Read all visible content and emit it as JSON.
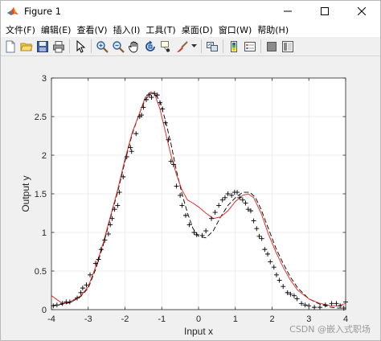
{
  "window": {
    "title": "Figure 1"
  },
  "menu": {
    "items": [
      "文件(F)",
      "编辑(E)",
      "查看(V)",
      "插入(I)",
      "工具(T)",
      "桌面(D)",
      "窗口(W)",
      "帮助(H)"
    ]
  },
  "toolbar": {
    "icons": [
      "new-figure-icon",
      "open-file-icon",
      "save-icon",
      "print-icon",
      "select-arrow-icon",
      "zoom-in-icon",
      "zoom-out-icon",
      "pan-hand-icon",
      "rotate-3d-icon",
      "data-cursor-icon",
      "brush-icon",
      "link-plot-icon",
      "colorbar-icon",
      "legend-icon",
      "hide-plot-tools-icon",
      "show-plot-tools-icon"
    ]
  },
  "watermark": "CSDN @嵌入式职场",
  "colors": {
    "fit_line": "#e8302a",
    "true_line": "#000000",
    "grid": "#e6e6e6"
  },
  "chart_data": {
    "type": "line",
    "xlabel": "Input x",
    "ylabel": "Output y",
    "xlim": [
      -4,
      4
    ],
    "ylim": [
      0,
      3
    ],
    "xticks": [
      "-4",
      "-3",
      "-2",
      "-1",
      "0",
      "1",
      "2",
      "3",
      "4"
    ],
    "yticks": [
      "0",
      "0.5",
      "1",
      "1.5",
      "2",
      "2.5",
      "3"
    ],
    "grid": true,
    "series": [
      {
        "kind": "fitted-red-line",
        "x": [
          -4,
          -3.7,
          -3.5,
          -3.2,
          -3.0,
          -2.8,
          -2.6,
          -2.4,
          -2.2,
          -2.0,
          -1.8,
          -1.6,
          -1.45,
          -1.3,
          -1.2,
          -1.05,
          -0.9,
          -0.75,
          -0.6,
          -0.45,
          -0.3,
          -0.15,
          0.0,
          0.2,
          0.4,
          0.6,
          0.8,
          1.0,
          1.2,
          1.35,
          1.5,
          1.7,
          1.9,
          2.1,
          2.3,
          2.5,
          2.7,
          3.0,
          3.3,
          3.6,
          3.8,
          4.0
        ],
        "y": [
          0.18,
          0.08,
          0.1,
          0.18,
          0.3,
          0.55,
          0.85,
          1.2,
          1.55,
          1.95,
          2.3,
          2.55,
          2.75,
          2.82,
          2.8,
          2.6,
          2.3,
          2.0,
          1.75,
          1.55,
          1.42,
          1.38,
          1.33,
          1.25,
          1.18,
          1.2,
          1.28,
          1.4,
          1.48,
          1.5,
          1.45,
          1.25,
          0.98,
          0.75,
          0.55,
          0.38,
          0.25,
          0.14,
          0.08,
          0.05,
          0.05,
          0.08
        ]
      },
      {
        "kind": "true-dashed-line",
        "x": [
          -4,
          -3.7,
          -3.5,
          -3.2,
          -3.0,
          -2.8,
          -2.6,
          -2.4,
          -2.2,
          -2.0,
          -1.8,
          -1.6,
          -1.45,
          -1.3,
          -1.2,
          -1.05,
          -0.9,
          -0.75,
          -0.6,
          -0.45,
          -0.3,
          -0.15,
          0.0,
          0.2,
          0.4,
          0.6,
          0.8,
          1.0,
          1.2,
          1.4,
          1.55,
          1.7,
          1.9,
          2.1,
          2.3,
          2.5,
          2.7,
          3.0,
          3.3,
          3.6,
          3.8,
          4.0
        ],
        "y": [
          0.05,
          0.07,
          0.09,
          0.17,
          0.28,
          0.52,
          0.82,
          1.18,
          1.52,
          1.92,
          2.28,
          2.55,
          2.72,
          2.8,
          2.8,
          2.7,
          2.45,
          2.15,
          1.8,
          1.5,
          1.25,
          1.05,
          0.95,
          0.93,
          1.02,
          1.2,
          1.35,
          1.45,
          1.52,
          1.52,
          1.45,
          1.3,
          1.05,
          0.8,
          0.6,
          0.42,
          0.28,
          0.14,
          0.07,
          0.03,
          0.02,
          0.02
        ]
      },
      {
        "kind": "training-samples-plus-markers",
        "x": [
          -3.95,
          -3.85,
          -3.7,
          -3.6,
          -3.5,
          -3.3,
          -3.2,
          -3.15,
          -3.05,
          -2.95,
          -2.8,
          -2.72,
          -2.65,
          -2.55,
          -2.45,
          -2.4,
          -2.35,
          -2.28,
          -2.2,
          -2.15,
          -2.05,
          -1.95,
          -1.85,
          -1.82,
          -1.7,
          -1.6,
          -1.55,
          -1.5,
          -1.42,
          -1.35,
          -1.28,
          -1.2,
          -1.12,
          -1.05,
          -0.98,
          -0.9,
          -0.82,
          -0.75,
          -0.68,
          -0.6,
          -0.5,
          -0.45,
          -0.35,
          -0.25,
          -0.12,
          -0.05,
          0.1,
          0.2,
          0.35,
          0.45,
          0.55,
          0.65,
          0.72,
          0.8,
          0.9,
          0.98,
          1.05,
          1.12,
          1.2,
          1.28,
          1.35,
          1.42,
          1.5,
          1.58,
          1.65,
          1.72,
          1.8,
          1.88,
          1.95,
          2.05,
          2.12,
          2.2,
          2.3,
          2.42,
          2.5,
          2.6,
          2.68,
          2.8,
          2.9,
          3.0,
          3.15,
          3.3,
          3.45,
          3.62,
          3.75,
          3.85,
          3.95,
          4.0
        ],
        "y": [
          0.05,
          0.06,
          0.08,
          0.1,
          0.1,
          0.15,
          0.22,
          0.28,
          0.32,
          0.45,
          0.6,
          0.65,
          0.78,
          0.9,
          0.98,
          1.1,
          1.18,
          1.3,
          1.35,
          1.52,
          1.72,
          1.98,
          2.1,
          2.05,
          2.28,
          2.5,
          2.52,
          2.62,
          2.72,
          2.78,
          2.75,
          2.8,
          2.78,
          2.68,
          2.6,
          2.42,
          2.2,
          1.92,
          1.88,
          1.6,
          1.48,
          1.35,
          1.22,
          1.1,
          1.0,
          0.97,
          0.96,
          1.02,
          1.18,
          1.26,
          1.35,
          1.42,
          1.45,
          1.5,
          1.48,
          1.52,
          1.52,
          1.45,
          1.42,
          1.38,
          1.3,
          1.28,
          1.15,
          1.05,
          0.95,
          0.92,
          0.78,
          0.72,
          0.62,
          0.55,
          0.45,
          0.38,
          0.3,
          0.22,
          0.2,
          0.18,
          0.14,
          0.08,
          0.06,
          0.05,
          0.03,
          0.03,
          0.06,
          0.08,
          0.08,
          0.05,
          0.02,
          0.1
        ]
      }
    ]
  }
}
